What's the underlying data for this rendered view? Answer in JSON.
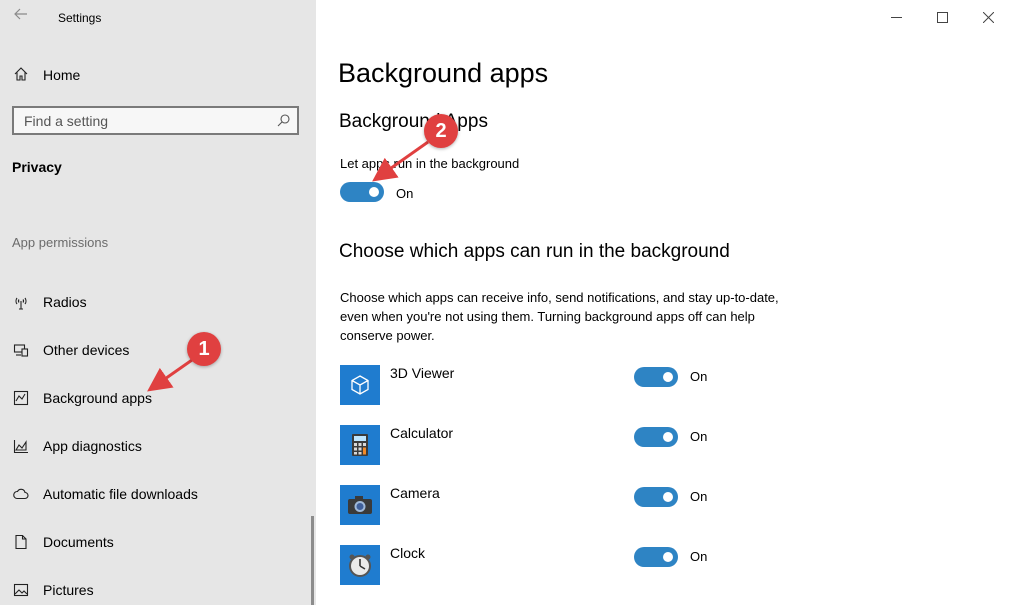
{
  "window": {
    "title": "Settings"
  },
  "sidebar": {
    "home_label": "Home",
    "search_placeholder": "Find a setting",
    "section_title": "Privacy",
    "group_label": "App permissions",
    "items": [
      {
        "label": "Radios",
        "icon": "radio-tower-icon"
      },
      {
        "label": "Other devices",
        "icon": "devices-icon"
      },
      {
        "label": "Background apps",
        "icon": "background-apps-icon"
      },
      {
        "label": "App diagnostics",
        "icon": "diagnostics-icon"
      },
      {
        "label": "Automatic file downloads",
        "icon": "cloud-icon"
      },
      {
        "label": "Documents",
        "icon": "document-icon"
      },
      {
        "label": "Pictures",
        "icon": "picture-icon"
      }
    ]
  },
  "main": {
    "page_title": "Background apps",
    "section1_title": "Background Apps",
    "let_apps_label": "Let apps run in the background",
    "master_toggle_state": "On",
    "section2_title": "Choose which apps can run in the background",
    "description": "Choose which apps can receive info, send notifications, and stay up-to-date, even when you're not using them. Turning background apps off can help conserve power.",
    "apps": [
      {
        "name": "3D Viewer",
        "state": "On",
        "icon": "cube-icon"
      },
      {
        "name": "Calculator",
        "state": "On",
        "icon": "calculator-icon"
      },
      {
        "name": "Camera",
        "state": "On",
        "icon": "camera-icon"
      },
      {
        "name": "Clock",
        "state": "On",
        "icon": "clock-icon"
      }
    ]
  },
  "annotations": {
    "badge1": "1",
    "badge2": "2"
  },
  "colors": {
    "accent": "#2e84c4",
    "sidebar_bg": "#e6e6e6",
    "tile": "#1f7ccf",
    "annotation": "#e04040"
  }
}
